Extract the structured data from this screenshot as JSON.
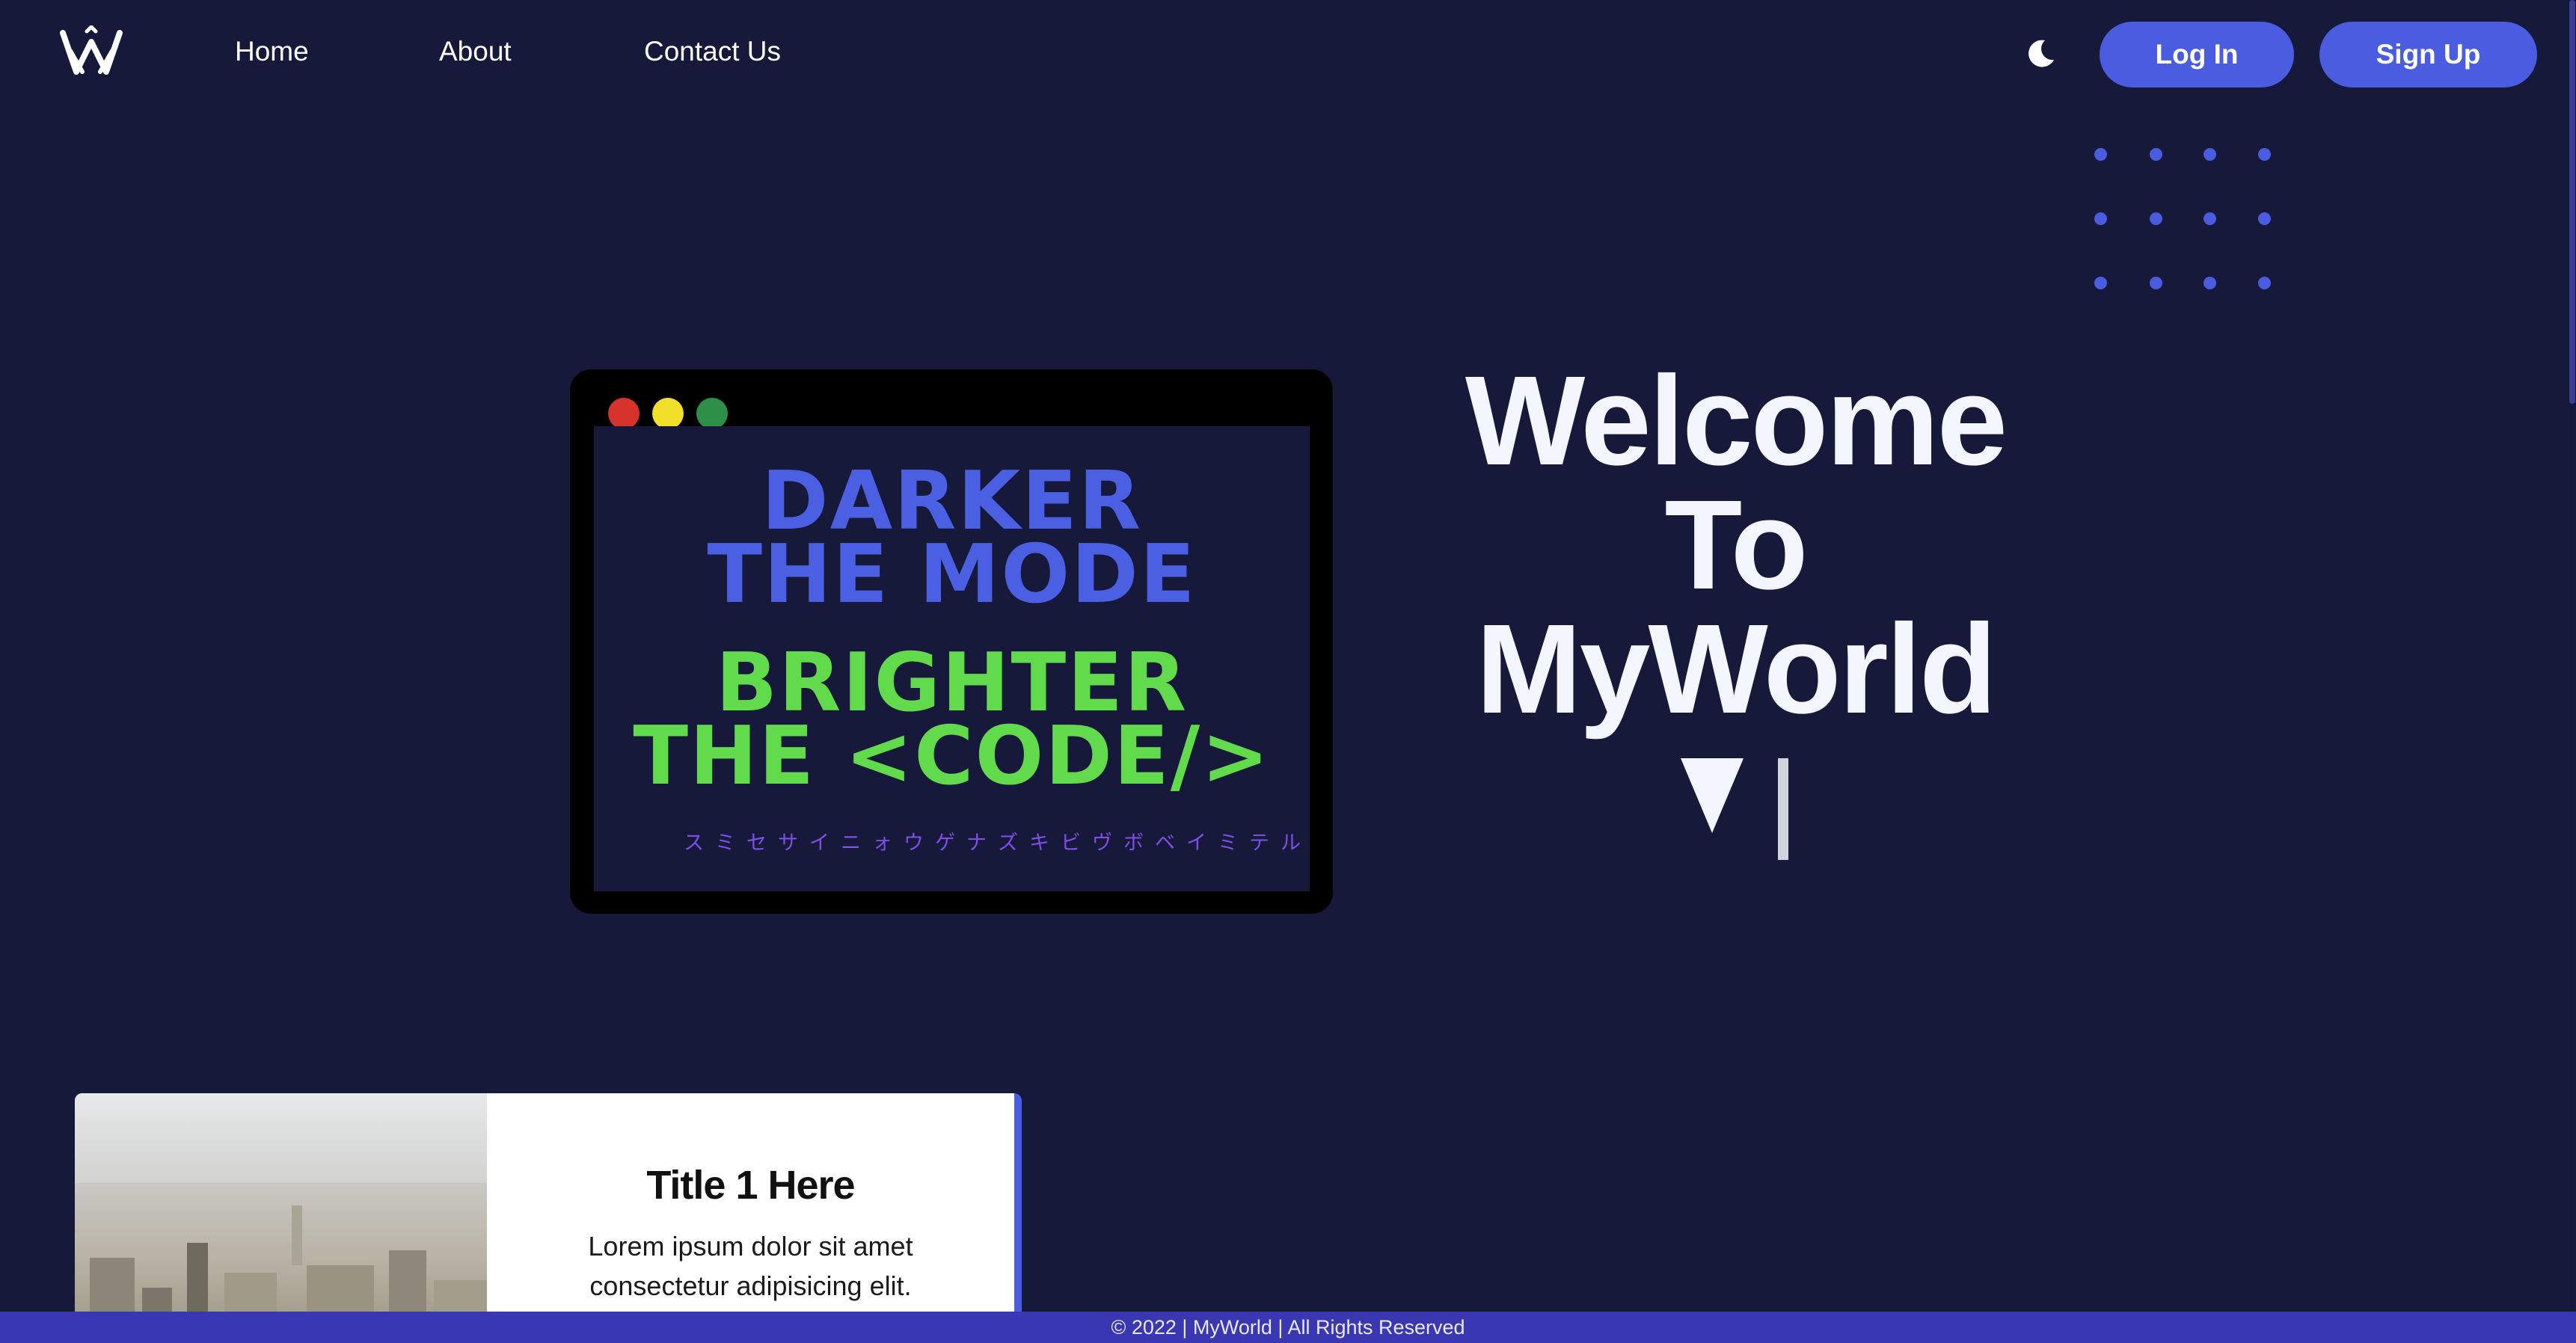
{
  "nav": {
    "logo_icon": "crown-logo-icon",
    "links": [
      "Home",
      "About",
      "Contact Us"
    ],
    "theme_icon": "moon-icon",
    "login_label": "Log In",
    "signup_label": "Sign Up"
  },
  "decor": {
    "dot_grid_rows": 3,
    "dot_grid_cols": 4,
    "accent_color": "#4a5de0"
  },
  "window": {
    "slogan_line1": "DARKER",
    "slogan_line2": "THE MODE",
    "slogan_line3": "BRIGHTER",
    "slogan_line4": "THE <CODE/>",
    "katakana": "スミセサイニォウゲナズキビヴボベイミテル"
  },
  "hero": {
    "line1": "Welcome",
    "line2": "To",
    "line3": "MyWorld"
  },
  "card": {
    "title": "Title 1 Here",
    "text": "Lorem ipsum dolor sit amet consectetur adipisicing elit."
  },
  "footer": {
    "text": "© 2022 | MyWorld | All Rights Reserved"
  },
  "colors": {
    "background": "#16193a",
    "accent": "#4a5de0",
    "slogan_blue": "#4b5fe2",
    "slogan_green": "#61da4b",
    "footer": "#3a37b2"
  }
}
